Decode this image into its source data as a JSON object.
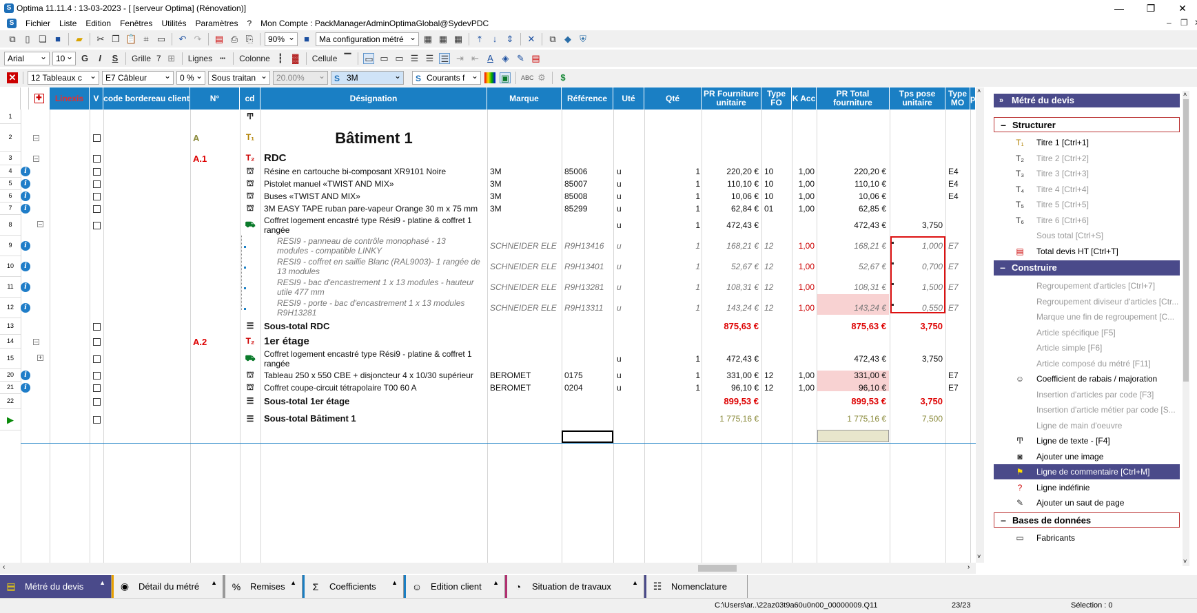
{
  "window": {
    "title": "Optima 11.11.4 : 13-03-2023 - [ [serveur Optima] (Rénovation)]",
    "minimize": "—",
    "maximize": "❐",
    "close": "✕"
  },
  "menu": {
    "items": [
      "Fichier",
      "Liste",
      "Edition",
      "Fenêtres",
      "Utilités",
      "Paramètres",
      "?",
      "Mon Compte : PackManagerAdminOptimaGlobal@SydevPDC"
    ]
  },
  "toolbar1": {
    "zoom": "90%",
    "config": "Ma configuration métré"
  },
  "toolbar2": {
    "font": "Arial",
    "size": "10",
    "bold": "G",
    "italic": "I",
    "strike": "S",
    "grid_label": "Grille",
    "grid_value": "7",
    "lines_label": "Lignes",
    "columns_label": "Colonne",
    "cell_label": "Cellule"
  },
  "toolbar3": {
    "tables": "12 Tableaux c",
    "cabler": "E7 Câbleur",
    "percent": "0 %",
    "subcontract": "Sous traitan",
    "rate": "20.00%",
    "brand": "3M",
    "currents": "Courants f"
  },
  "columns": {
    "linexis": "Linexis",
    "v": "V",
    "code": "code bordereau client",
    "num": "N°",
    "cd": "cd",
    "designation": "Désignation",
    "brand": "Marque",
    "ref": "Référence",
    "unit": "Uté",
    "qty": "Qté",
    "pr_unit": "PR Fourniture unitaire",
    "type_fo": "Type FO",
    "k_acc": "K Acc",
    "pr_total": "PR Total fourniture",
    "tps": "Tps pose unitaire",
    "type_mo": "Type MO",
    "extra": "p"
  },
  "rows": [
    {
      "n": "1",
      "num": "",
      "desc": "",
      "brand": "",
      "ref": "",
      "unit": "",
      "qty": "",
      "pru": "",
      "tfo": "",
      "k": "",
      "prt": "",
      "tps": "",
      "tmo": ""
    },
    {
      "n": "2",
      "num": "A",
      "desc": "Bâtiment 1",
      "brand": "",
      "ref": "",
      "unit": "",
      "qty": "",
      "pru": "",
      "tfo": "",
      "k": "",
      "prt": "",
      "tps": "",
      "tmo": ""
    },
    {
      "n": "3",
      "num": "A.1",
      "desc": "RDC",
      "brand": "",
      "ref": "",
      "unit": "",
      "qty": "",
      "pru": "",
      "tfo": "",
      "k": "",
      "prt": "",
      "tps": "",
      "tmo": ""
    },
    {
      "n": "4",
      "num": "",
      "desc": "Résine en cartouche bi-composant XR9101 Noire",
      "brand": "3M",
      "ref": "85006",
      "unit": "u",
      "qty": "1",
      "pru": "220,20 €",
      "tfo": "10",
      "k": "1,00",
      "prt": "220,20 €",
      "tps": "",
      "tmo": "E4"
    },
    {
      "n": "5",
      "num": "",
      "desc": "Pistolet manuel «TWIST AND MIX»",
      "brand": "3M",
      "ref": "85007",
      "unit": "u",
      "qty": "1",
      "pru": "110,10 €",
      "tfo": "10",
      "k": "1,00",
      "prt": "110,10 €",
      "tps": "",
      "tmo": "E4"
    },
    {
      "n": "6",
      "num": "",
      "desc": "Buses «TWIST AND MIX»",
      "brand": "3M",
      "ref": "85008",
      "unit": "u",
      "qty": "1",
      "pru": "10,06 €",
      "tfo": "10",
      "k": "1,00",
      "prt": "10,06 €",
      "tps": "",
      "tmo": "E4"
    },
    {
      "n": "7",
      "num": "",
      "desc": "3M EASY TAPE ruban pare-vapeur Orange 30 m x 75 mm",
      "brand": "3M",
      "ref": "85299",
      "unit": "u",
      "qty": "1",
      "pru": "62,84 €",
      "tfo": "01",
      "k": "1,00",
      "prt": "62,85 €",
      "tps": "",
      "tmo": ""
    },
    {
      "n": "8",
      "num": "",
      "desc": "Coffret logement encastré type Rési9 - platine & coffret 1",
      "desc2": "rangée",
      "brand": "",
      "ref": "",
      "unit": "u",
      "qty": "1",
      "pru": "472,43 €",
      "tfo": "",
      "k": "",
      "prt": "472,43 €",
      "tps": "3,750",
      "tmo": ""
    },
    {
      "n": "9",
      "num": "",
      "desc": "RESI9 - panneau de contrôle monophasé - 13",
      "desc2": "modules - compatible LINKY",
      "brand": "SCHNEIDER ELE",
      "ref": "R9H13416",
      "unit": "u",
      "qty": "1",
      "pru": "168,21 €",
      "tfo": "12",
      "k": "1,00",
      "prt": "168,21 €",
      "tps": "1,000",
      "tmo": "E7"
    },
    {
      "n": "10",
      "num": "",
      "desc": "RESI9 - coffret en saillie Blanc (RAL9003)- 1 rangée de",
      "desc2": "13 modules",
      "brand": "SCHNEIDER ELE",
      "ref": "R9H13401",
      "unit": "u",
      "qty": "1",
      "pru": "52,67 €",
      "tfo": "12",
      "k": "1,00",
      "prt": "52,67 €",
      "tps": "0,700",
      "tmo": "E7"
    },
    {
      "n": "11",
      "num": "",
      "desc": "RESI9 - bac d'encastrement 1 x 13 modules - hauteur",
      "desc2": "utile 477 mm",
      "brand": "SCHNEIDER ELE",
      "ref": "R9H13281",
      "unit": "u",
      "qty": "1",
      "pru": "108,31 €",
      "tfo": "12",
      "k": "1,00",
      "prt": "108,31 €",
      "tps": "1,500",
      "tmo": "E7"
    },
    {
      "n": "12",
      "num": "",
      "desc": "RESI9 - porte - bac d'encastrement 1 x 13 modules",
      "desc2": "R9H13281",
      "brand": "SCHNEIDER ELE",
      "ref": "R9H13311",
      "unit": "u",
      "qty": "1",
      "pru": "143,24 €",
      "tfo": "12",
      "k": "1,00",
      "prt": "143,24 €",
      "tps": "0,550",
      "tmo": "E7"
    },
    {
      "n": "13",
      "num": "",
      "desc": "Sous-total RDC",
      "brand": "",
      "ref": "",
      "unit": "",
      "qty": "",
      "pru": "875,63 €",
      "tfo": "",
      "k": "",
      "prt": "875,63 €",
      "tps": "3,750",
      "tmo": ""
    },
    {
      "n": "14",
      "num": "A.2",
      "desc": "1er étage",
      "brand": "",
      "ref": "",
      "unit": "",
      "qty": "",
      "pru": "",
      "tfo": "",
      "k": "",
      "prt": "",
      "tps": "",
      "tmo": ""
    },
    {
      "n": "15",
      "num": "",
      "desc": "Coffret logement encastré type Rési9 - platine & coffret 1",
      "desc2": "rangée",
      "brand": "",
      "ref": "",
      "unit": "u",
      "qty": "1",
      "pru": "472,43 €",
      "tfo": "",
      "k": "",
      "prt": "472,43 €",
      "tps": "3,750",
      "tmo": ""
    },
    {
      "n": "20",
      "num": "",
      "desc": "Tableau 250 x 550 CBE + disjoncteur 4 x 10/30 supérieur",
      "brand": "BEROMET",
      "ref": "0175",
      "unit": "u",
      "qty": "1",
      "pru": "331,00 €",
      "tfo": "12",
      "k": "1,00",
      "prt": "331,00 €",
      "tps": "",
      "tmo": "E7"
    },
    {
      "n": "21",
      "num": "",
      "desc": "Coffret coupe-circuit tétrapolaire T00 60 A",
      "brand": "BEROMET",
      "ref": "0204",
      "unit": "u",
      "qty": "1",
      "pru": "96,10 €",
      "tfo": "12",
      "k": "1,00",
      "prt": "96,10 €",
      "tps": "",
      "tmo": "E7"
    },
    {
      "n": "22",
      "num": "",
      "desc": "Sous-total 1er étage",
      "brand": "",
      "ref": "",
      "unit": "",
      "qty": "",
      "pru": "899,53 €",
      "tfo": "",
      "k": "",
      "prt": "899,53 €",
      "tps": "3,750",
      "tmo": ""
    },
    {
      "n": "",
      "num": "",
      "desc": "Sous-total Bâtiment 1",
      "brand": "",
      "ref": "",
      "unit": "",
      "qty": "",
      "pru": "1 775,16 €",
      "tfo": "",
      "k": "",
      "prt": "1 775,16 €",
      "tps": "7,500",
      "tmo": ""
    }
  ],
  "panel": {
    "title": "Métré du devis",
    "sections": [
      {
        "label": "Structurer",
        "items": [
          "Titre 1 [Ctrl+1]",
          "Titre 2 [Ctrl+2]",
          "Titre 3 [Ctrl+3]",
          "Titre 4 [Ctrl+4]",
          "Titre 5 [Ctrl+5]",
          "Titre 6 [Ctrl+6]",
          "Sous total [Ctrl+S]",
          "Total devis HT [Ctrl+T]"
        ]
      },
      {
        "label": "Construire",
        "items": [
          "Regroupement d'articles  [Ctrl+7]",
          "Regroupement diviseur d'articles [Ctr...",
          "Marque une fin de regroupement   [C...",
          "Article spécifique [F5]",
          "Article simple [F6]",
          "Article composé du métré [F11]",
          "Coefficient de rabais / majoration",
          "Insertion d'articles par code [F3]",
          "Insertion d'article métier par code [S...",
          "Ligne de main d'oeuvre",
          "Ligne de texte - [F4]",
          "Ajouter une image",
          "Ligne de commentaire [Ctrl+M]",
          "Ligne indéfinie",
          "Ajouter un saut de page"
        ]
      },
      {
        "label": "Bases de données",
        "items": [
          "Fabricants"
        ]
      }
    ]
  },
  "tabs": [
    "Métré du devis",
    "Détail du métré",
    "Remises",
    "Coefficients",
    "Edition client",
    "Situation de travaux",
    "Nomenclature"
  ],
  "status": {
    "path": "C:\\Users\\ar..\\22az03t9a60u0n00_00000009.Q11",
    "count": "23/23",
    "selection": "Sélection : 0"
  }
}
